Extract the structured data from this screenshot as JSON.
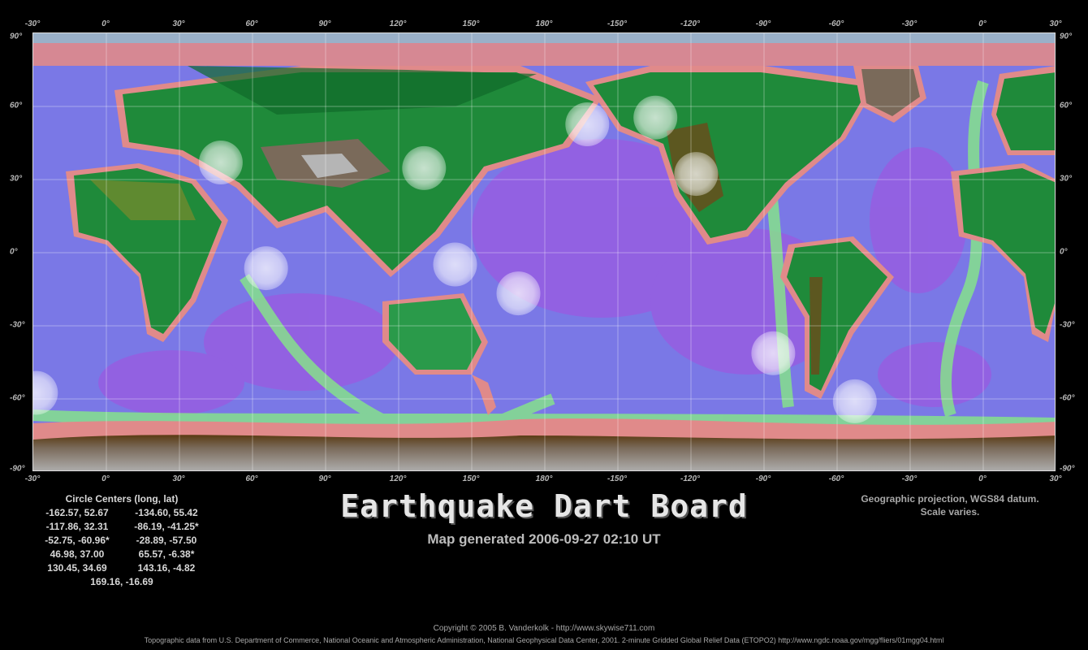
{
  "map": {
    "projection_note_line1": "Geographic projection, WGS84 datum.",
    "projection_note_line2": "Scale varies.",
    "lon_ticks": [
      "-30°",
      "0°",
      "30°",
      "60°",
      "90°",
      "120°",
      "150°",
      "180°",
      "-150°",
      "-120°",
      "-90°",
      "-60°",
      "-30°",
      "0°",
      "30°"
    ],
    "lat_ticks": [
      "90°",
      "60°",
      "30°",
      "0°",
      "-30°",
      "-60°",
      "-90°"
    ],
    "colors": {
      "ocean_deep": "#8a5be0",
      "ocean_mid": "#6f86e8",
      "shelf_green": "#7fe87f",
      "coast_pink": "#e07f7f",
      "land_green": "#1f8a3a",
      "highland_olive": "#8a8a2a",
      "mountain_brown": "#6b4a1a",
      "ice_gray": "#a8a8a8",
      "circle": "#ffffff"
    },
    "circles": [
      {
        "lon": -162.57,
        "lat": 52.67
      },
      {
        "lon": -134.6,
        "lat": 55.42
      },
      {
        "lon": -117.86,
        "lat": 32.31
      },
      {
        "lon": -86.19,
        "lat": -41.25
      },
      {
        "lon": -52.75,
        "lat": -60.96
      },
      {
        "lon": -28.89,
        "lat": -57.5
      },
      {
        "lon": 46.98,
        "lat": 37.0
      },
      {
        "lon": 65.57,
        "lat": -6.38
      },
      {
        "lon": 130.45,
        "lat": 34.69
      },
      {
        "lon": 143.16,
        "lat": -4.82
      },
      {
        "lon": 169.16,
        "lat": -16.69
      }
    ]
  },
  "circle_centers": {
    "title": "Circle Centers (long, lat)",
    "rows": [
      [
        "-162.57,  52.67",
        "-134.60,  55.42"
      ],
      [
        "-117.86,  32.31",
        "-86.19, -41.25*"
      ],
      [
        "-52.75, -60.96*",
        "-28.89, -57.50"
      ],
      [
        "46.98,  37.00",
        "65.57,  -6.38*"
      ],
      [
        "130.45,  34.69",
        "143.16,  -4.82"
      ],
      [
        "169.16, -16.69",
        ""
      ]
    ]
  },
  "title": "Earthquake Dart Board",
  "subtitle": "Map generated 2006-09-27 02:10 UT",
  "footer": {
    "copyright": "Copyright © 2005 B. Vanderkolk - http://www.skywise711.com",
    "credits": "Topographic data from U.S. Department of Commerce, National Oceanic and Atmospheric Administration, National Geophysical Data Center, 2001. 2-minute Gridded Global Relief Data (ETOPO2) http://www.ngdc.noaa.gov/mgg/fliers/01mgg04.html"
  }
}
